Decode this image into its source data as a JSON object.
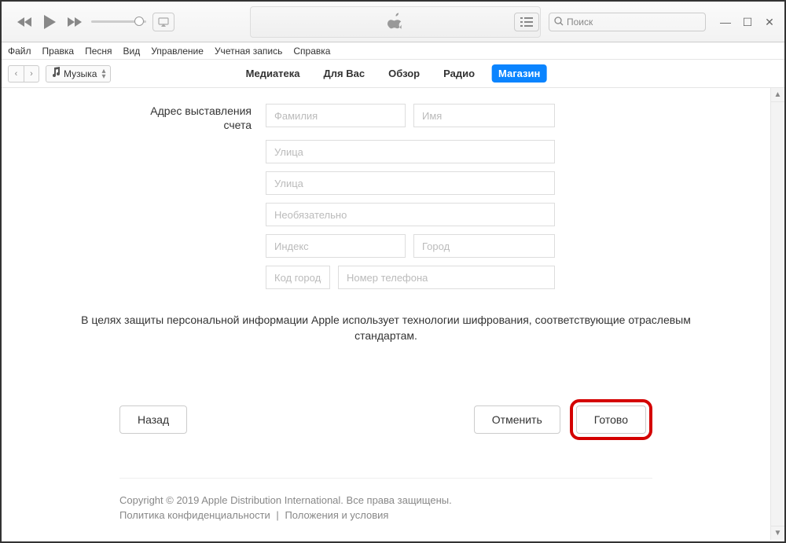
{
  "menubar": {
    "file": "Файл",
    "edit": "Правка",
    "song": "Песня",
    "view": "Вид",
    "controls": "Управление",
    "account": "Учетная запись",
    "help": "Справка"
  },
  "media_selector": {
    "label": "Музыка"
  },
  "tabs": {
    "library": "Медиатека",
    "foryou": "Для Вас",
    "browse": "Обзор",
    "radio": "Радио",
    "store": "Магазин"
  },
  "search": {
    "placeholder": "Поиск"
  },
  "form": {
    "label_line1": "Адрес выставления",
    "label_line2": "счета",
    "placeholders": {
      "lastname": "Фамилия",
      "firstname": "Имя",
      "street": "Улица",
      "street2": "Улица",
      "optional": "Необязательно",
      "index": "Индекс",
      "city": "Город",
      "areacode": "Код города",
      "phone": "Номер телефона"
    }
  },
  "privacy_note": "В целях защиты персональной информации Apple использует технологии шифрования, соответствующие отраслевым стандартам.",
  "buttons": {
    "back": "Назад",
    "cancel": "Отменить",
    "done": "Готово"
  },
  "footer": {
    "copyright": "Copyright © 2019 Apple Distribution International. Все права защищены.",
    "privacy": "Политика конфиденциальности",
    "terms": "Положения и условия"
  }
}
